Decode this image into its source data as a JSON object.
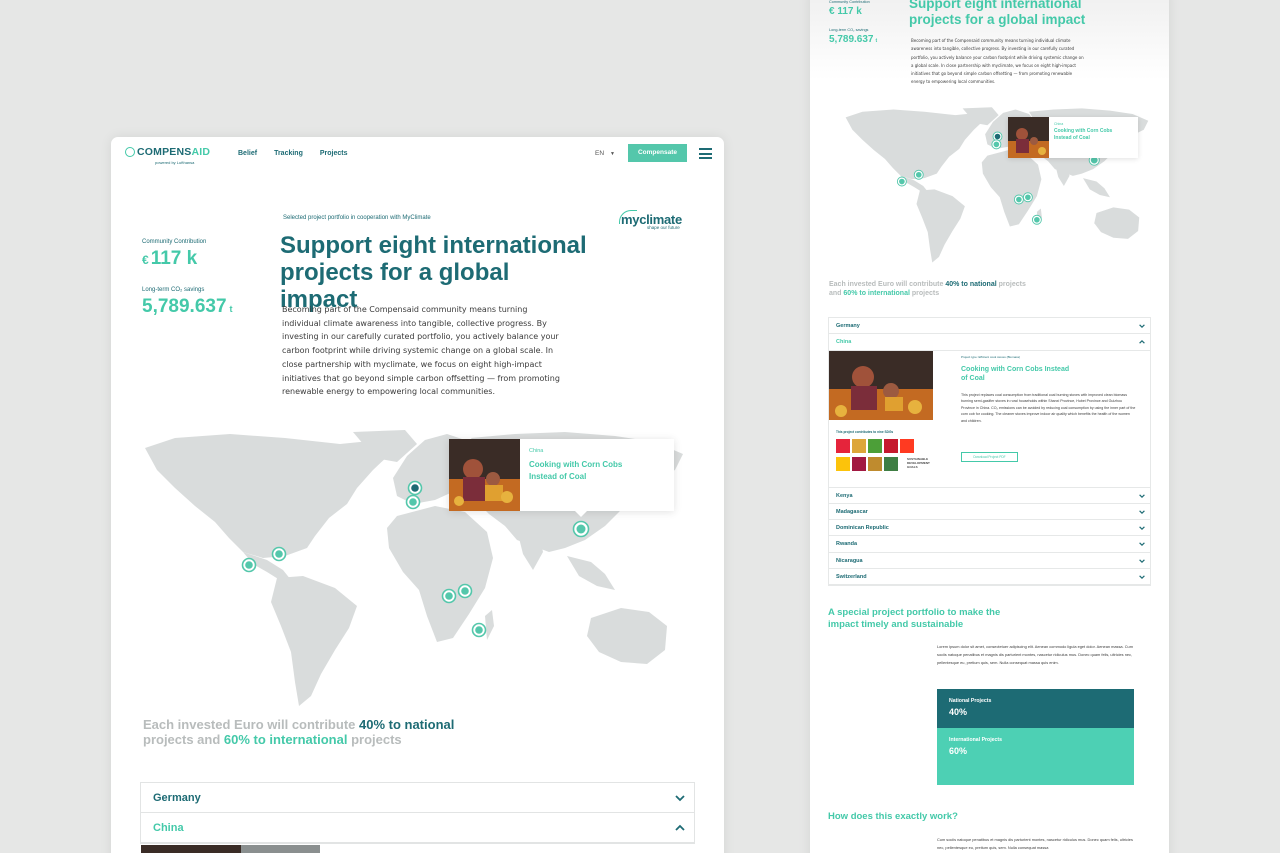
{
  "brand": {
    "logo_main": "COMPENS",
    "logo_accent": "AID",
    "logo_sub": "powered by Lufthansa",
    "partner_name": "myclimate",
    "partner_tagline": "shape our future"
  },
  "nav": {
    "links": [
      "Belief",
      "Tracking",
      "Projects"
    ],
    "language": "EN",
    "cta": "Compensate"
  },
  "stats": {
    "community_label": "Community Contribution",
    "community_currency": "€",
    "community_value": "117 k",
    "savings_label": "Long-term CO₂ savings",
    "savings_value": "5,789.637",
    "savings_unit": "t"
  },
  "hero": {
    "eyebrow": "Selected project portfolio in cooperation with MyClimate",
    "headline": "Support eight international projects for a global impact",
    "body": "Becoming part of the Compensaid community means turning individual climate awareness into tangible, collective progress. By investing in our carefully curated portfolio, you actively balance your carbon footprint while driving systemic change on a global scale. In close partnership with myclimate, we focus on eight high-impact initiatives that go beyond simple carbon offsetting — from promoting renewable energy to empowering local communities."
  },
  "map_card": {
    "country": "China",
    "title": "Cooking with Corn Cobs Instead of Coal"
  },
  "split": {
    "prefix": "Each invested Euro will contribute",
    "national": "40% to national",
    "middle": "projects and",
    "international": "60% to international",
    "suffix": "projects"
  },
  "accordion": {
    "countries": [
      "Germany",
      "China",
      "Kenya",
      "Madagascar",
      "Dominican Republic",
      "Rwanda",
      "Nicaragua",
      "Switzerland"
    ],
    "open_country": "China",
    "detail": {
      "project_type": "Project type: Efficient cook stoves (Biomass)",
      "title": "Cooking with Corn Cobs Instead of Coal",
      "description": "This project replaces coal consumption from traditional coal burning stoves with improved clean biomass burning semi-gasifier stoves in rural households within Shanxi Province, Hubei Province and Guizhou Province in China. CO₂ emissions can be avoided by reducing coal consumption by using the inner part of the corn cob for cooking. The cleaner stoves improve indoor air quality which benefits the health of the women and children.",
      "sdg_label": "This project contributes to nine SDGs",
      "sdg_logo": "SUSTAINABLE DEVELOPMENT GOALS",
      "pdf_button": "Download Project PDF"
    }
  },
  "special": {
    "heading": "A special project portfolio to make the impact timely and sustainable",
    "body": "Lorem ipsum dolor sit amet, consectetuer adipiscing elit. Aenean commodo ligula eget dolor. Aenean massa. Cum sociis natoque penatibus et magnis dis parturient montes, nascetur ridiculus mus. Donec quam felis, ultricies nec, pellentesque eu, pretium quis, sem. Nulla consequat massa quis enim."
  },
  "split_bars": {
    "national_label": "National Projects",
    "national_value": "40%",
    "international_label": "International Projects",
    "international_value": "60%"
  },
  "how": {
    "heading": "How does this exactly work?",
    "body": "Cum sociis natoque penatibus et magnis dis parturient montes, nascetur ridiculus mus. Donec quam felis, ultricies nec, pellentesque eu, pretium quis, sem. Nulla consequat massa"
  },
  "colors": {
    "teal_dark": "#1d6b74",
    "mint": "#44c9a9",
    "map_land": "#d9dcdc"
  }
}
